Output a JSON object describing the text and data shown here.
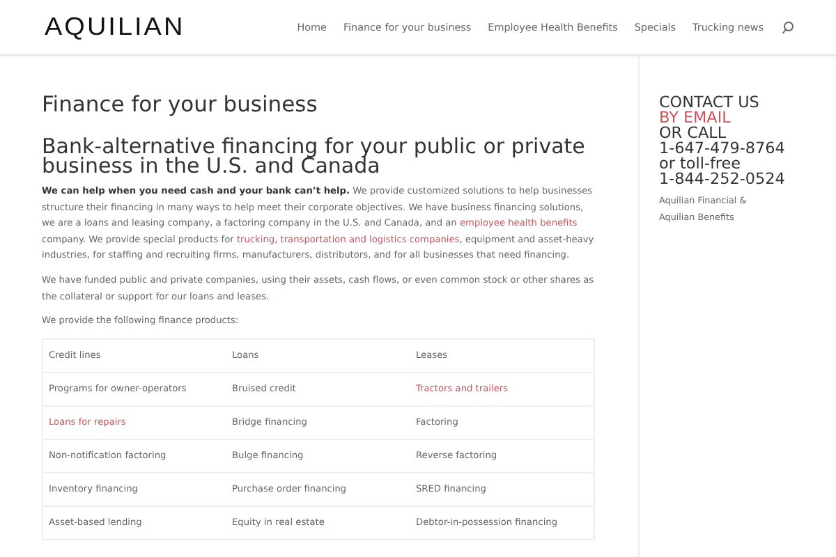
{
  "header": {
    "logo": "AQUILIAN",
    "nav": [
      {
        "label": "Home",
        "selected": false
      },
      {
        "label": "Finance for your business",
        "selected": false
      },
      {
        "label": "Employee Health Benefits",
        "selected": false
      },
      {
        "label": "Specials",
        "selected": false
      },
      {
        "label": "Trucking news",
        "selected": false
      }
    ]
  },
  "main": {
    "title": "Finance for your business",
    "subtitle": "Bank-alternative financing for your public or private business in the U.S. and Canada",
    "paragraphs": [
      [
        {
          "kind": "bold",
          "text": "We can help when you need cash and your bank can’t help."
        },
        {
          "kind": "text",
          "text": " We provide customized solutions to help businesses structure their financing in many ways to help meet their corporate objectives. We have business financing solutions, we are a loans and leasing company, a factoring company in the U.S. and Canada, and an "
        },
        {
          "kind": "link",
          "text": "employee health benefits"
        },
        {
          "kind": "text",
          "text": " company. We provide special products for "
        },
        {
          "kind": "link",
          "text": "trucking, transportation and logistics companies"
        },
        {
          "kind": "text",
          "text": ", equipment and asset-heavy industries, for staffing and recruiting firms, manufacturers, distributors, and for all businesses that need financing."
        }
      ],
      [
        {
          "kind": "text",
          "text": "We have funded public and private companies, using their assets, cash flows, or even common stock or other shares as the collateral or support for our loans and leases."
        }
      ],
      [
        {
          "kind": "text",
          "text": "We provide the following finance products:"
        }
      ]
    ],
    "table": {
      "rows": [
        [
          {
            "kind": "text",
            "text": "Credit lines"
          },
          {
            "kind": "text",
            "text": "Loans"
          },
          {
            "kind": "text",
            "text": "Leases"
          }
        ],
        [
          {
            "kind": "text",
            "text": "Programs for owner-operators"
          },
          {
            "kind": "text",
            "text": "Bruised credit"
          },
          {
            "kind": "link",
            "text": "Tractors and trailers"
          }
        ],
        [
          {
            "kind": "link",
            "text": "Loans for repairs"
          },
          {
            "kind": "text",
            "text": "Bridge financing"
          },
          {
            "kind": "text",
            "text": "Factoring"
          }
        ],
        [
          {
            "kind": "text",
            "text": "Non-notification factoring"
          },
          {
            "kind": "text",
            "text": "Bulge financing"
          },
          {
            "kind": "text",
            "text": "Reverse factoring"
          }
        ],
        [
          {
            "kind": "text",
            "text": "Inventory financing"
          },
          {
            "kind": "text",
            "text": "Purchase order financing"
          },
          {
            "kind": "text",
            "text": "SRED financing"
          }
        ],
        [
          {
            "kind": "text",
            "text": "Asset-based lending"
          },
          {
            "kind": "text",
            "text": "Equity in real estate"
          },
          {
            "kind": "text",
            "text": "Debtor-in-possession financing"
          }
        ]
      ]
    }
  },
  "sidebar": {
    "contact": [
      {
        "kind": "text",
        "text": "CONTACT US"
      },
      {
        "kind": "link",
        "text": "BY EMAIL"
      },
      {
        "kind": "text",
        "text": "OR CALL"
      },
      {
        "kind": "text",
        "text": "1-647-479-8764"
      },
      {
        "kind": "text",
        "text": "or toll-free"
      },
      {
        "kind": "text",
        "text": "1-844-252-0524"
      }
    ],
    "notes": [
      "Aquilian Financial &",
      "Aquilian Benefits"
    ]
  }
}
